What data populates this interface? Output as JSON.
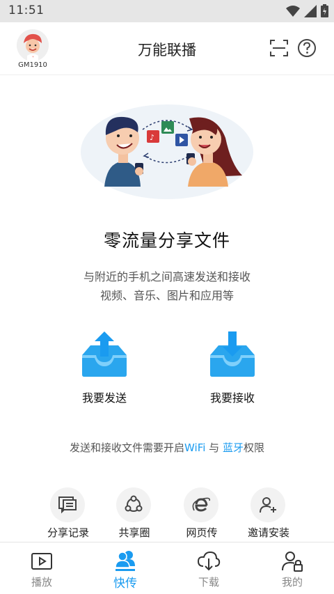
{
  "status_bar": {
    "time": "11:51"
  },
  "header": {
    "user_id": "GM1910",
    "title": "万能联播"
  },
  "main": {
    "headline": "零流量分享文件",
    "description_line1": "与附近的手机之间高速发送和接收",
    "description_line2": "视频、音乐、图片和应用等",
    "send_label": "我要发送",
    "receive_label": "我要接收",
    "notice": {
      "prefix": "发送和接收文件需要开启",
      "wifi": "WiFi",
      "middle": " 与 ",
      "bluetooth": "蓝牙",
      "suffix": "权限"
    }
  },
  "tools": [
    {
      "label": "分享记录",
      "icon": "chat-history-icon"
    },
    {
      "label": "共享圈",
      "icon": "share-circle-icon"
    },
    {
      "label": "网页传",
      "icon": "browser-e-icon"
    },
    {
      "label": "邀请安装",
      "icon": "invite-user-icon"
    }
  ],
  "tabs": [
    {
      "label": "播放",
      "icon": "play-icon",
      "active": false
    },
    {
      "label": "快传",
      "icon": "users-icon",
      "active": true
    },
    {
      "label": "下载",
      "icon": "cloud-download-icon",
      "active": false
    },
    {
      "label": "我的",
      "icon": "profile-icon",
      "active": false
    }
  ],
  "colors": {
    "accent": "#1a9bf0",
    "status_bar": "#e6e6e6",
    "icon_circle": "#f2f2f2"
  }
}
